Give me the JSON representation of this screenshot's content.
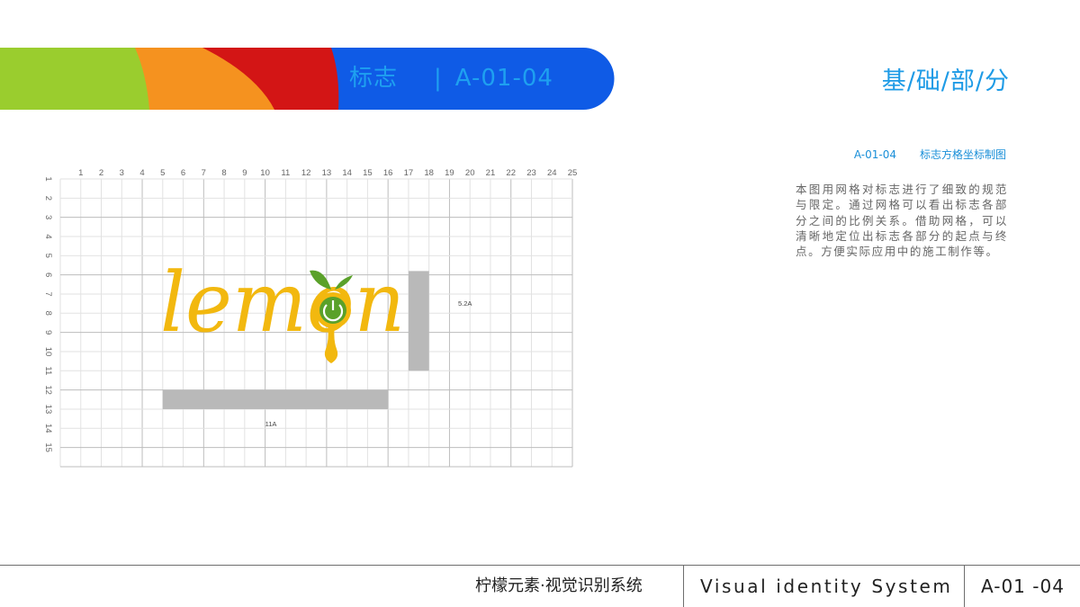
{
  "header": {
    "banner_label": "标志",
    "banner_separator": "|",
    "banner_code": "A-01-04",
    "section_title": "基/础/部/分",
    "colors": {
      "green": "#9acd2e",
      "orange": "#f5921f",
      "red": "#d31515",
      "blue": "#0f5be6",
      "banner_text": "#1ea0f0"
    }
  },
  "info": {
    "code": "A-01-04",
    "title": "标志方格坐标制图",
    "description": "本图用网格对标志进行了细致的规范与限定。通过网格可以看出标志各部分之间的比例关系。借助网格，可以清晰地定位出标志各部分的起点与终点。方便实际应用中的施工制作等。"
  },
  "grid": {
    "columns": 25,
    "rows": 15,
    "column_labels": [
      "1",
      "2",
      "3",
      "4",
      "5",
      "6",
      "7",
      "8",
      "9",
      "10",
      "11",
      "12",
      "13",
      "14",
      "15",
      "16",
      "17",
      "18",
      "19",
      "20",
      "21",
      "22",
      "23",
      "24",
      "25"
    ],
    "row_labels": [
      "1",
      "2",
      "3",
      "4",
      "5",
      "6",
      "7",
      "8",
      "9",
      "10",
      "11",
      "12",
      "13",
      "14",
      "15"
    ],
    "logo_text": "lemon",
    "logo_colors": {
      "yellow": "#f2b80f",
      "green": "#5aa12a"
    },
    "measure_bars": [
      {
        "name": "horizontal-width",
        "label": "11A",
        "col_start": 5,
        "col_end": 16,
        "row_start": 11,
        "row_end": 12
      },
      {
        "name": "vertical-height",
        "label": "5.2A",
        "col_start": 17,
        "col_end": 18,
        "row_start": 4.8,
        "row_end": 10
      }
    ],
    "bar_color": "#b9b9b9"
  },
  "footer": {
    "brand_cn": "柠檬元素·视觉识别系统",
    "brand_en": "Visual identity System",
    "page_code": "A-01 -04"
  }
}
